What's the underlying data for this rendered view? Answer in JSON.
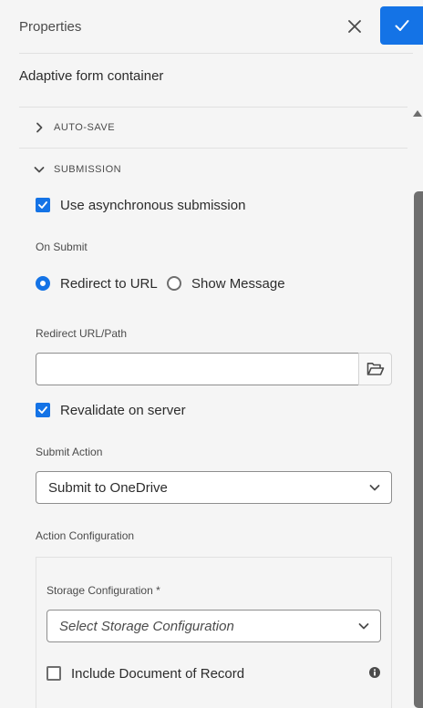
{
  "header": {
    "title": "Properties",
    "close_icon": "close-icon",
    "confirm_icon": "checkmark-icon"
  },
  "component": {
    "label": "Adaptive form container"
  },
  "accordion": {
    "autosave": {
      "label": "AUTO-SAVE",
      "expanded": false
    },
    "submission": {
      "label": "SUBMISSION",
      "expanded": true
    }
  },
  "submission": {
    "async_label": "Use asynchronous submission",
    "async_checked": true,
    "on_submit_label": "On Submit",
    "radio_redirect": "Redirect to URL",
    "radio_message": "Show Message",
    "selected": "Redirect to URL",
    "redirect_label": "Redirect URL/Path",
    "redirect_value": "",
    "revalidate_label": "Revalidate on server",
    "revalidate_checked": true,
    "submit_action_label": "Submit Action",
    "submit_action_value": "Submit to OneDrive",
    "action_config_label": "Action Configuration",
    "storage_label": "Storage Configuration *",
    "storage_placeholder": "Select Storage Configuration",
    "dor_label": "Include Document of Record",
    "dor_checked": false
  },
  "colors": {
    "accent": "#1473e6",
    "background": "#f5f5f5"
  }
}
